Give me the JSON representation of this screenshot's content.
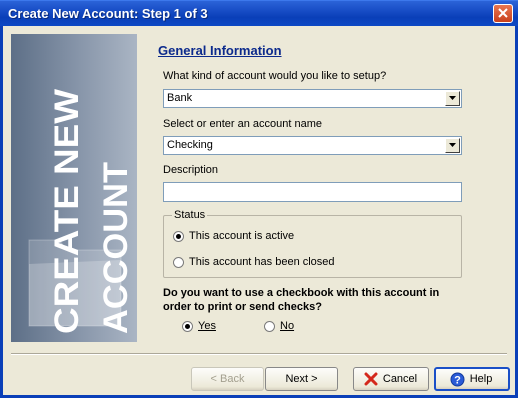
{
  "window": {
    "title": "Create New Account: Step 1 of 3"
  },
  "banner": {
    "line1": "CREATE NEW",
    "line2": "ACCOUNT"
  },
  "form": {
    "heading": "General Information",
    "account_kind_label": "What kind of account would you like to setup?",
    "account_kind_value": "Bank",
    "account_name_label": "Select or enter an account name",
    "account_name_value": "Checking",
    "description_label": "Description",
    "description_value": ""
  },
  "status": {
    "title": "Status",
    "options": [
      {
        "label": "This account is active",
        "checked": true
      },
      {
        "label": "This account has been closed",
        "checked": false
      }
    ]
  },
  "checkbook": {
    "question": "Do you want to use a checkbook with this account in order to print or send checks?",
    "yes_label": "Yes",
    "no_label": "No",
    "selected": "Yes"
  },
  "buttons": {
    "back": "< Back",
    "next": "Next >",
    "cancel": "Cancel",
    "help": "Help"
  },
  "icons": {
    "close": "close-icon",
    "cancel": "red-x-icon",
    "help": "help-icon",
    "banner": "folder-icon"
  },
  "colors": {
    "titlebar": "#0a3fb8",
    "heading": "#0c2a8c",
    "dialog_bg": "#ece9d8"
  }
}
